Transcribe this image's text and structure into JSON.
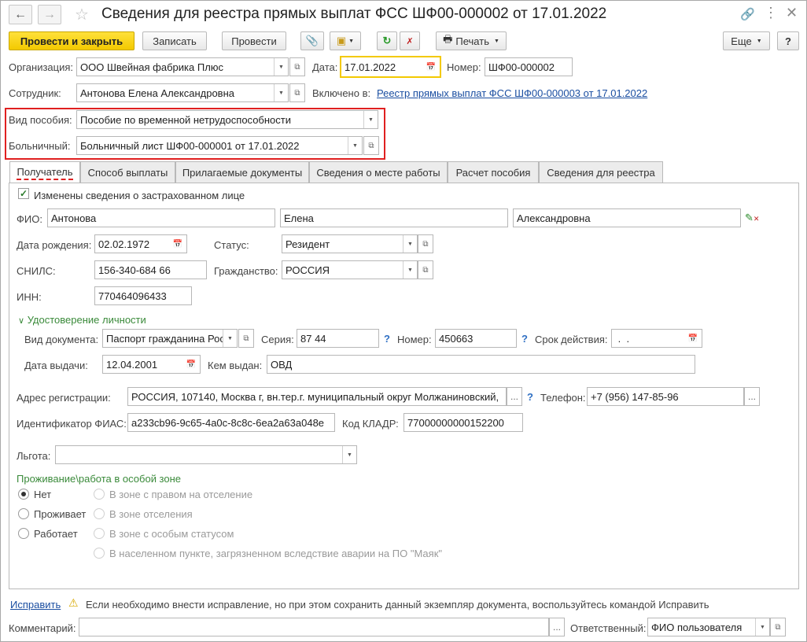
{
  "title": "Сведения для реестра прямых выплат ФСС ШФ00-000002 от 17.01.2022",
  "toolbar": {
    "post_close": "Провести и закрыть",
    "save": "Записать",
    "post": "Провести",
    "print": "Печать",
    "more": "Еще",
    "help": "?"
  },
  "header": {
    "org_label": "Организация:",
    "org_value": "ООО Швейная фабрика Плюс",
    "date_label": "Дата:",
    "date_value": "17.01.2022",
    "number_label": "Номер:",
    "number_value": "ШФ00-000002",
    "employee_label": "Сотрудник:",
    "employee_value": "Антонова Елена Александровна",
    "included_label": "Включено в:",
    "included_link": "Реестр прямых выплат ФСС ШФ00-000003 от 17.01.2022",
    "benefit_label": "Вид пособия:",
    "benefit_value": "Пособие по временной нетрудоспособности",
    "sick_label": "Больничный:",
    "sick_value": "Больничный лист ШФ00-000001 от 17.01.2022"
  },
  "tabs": [
    "Получатель",
    "Способ выплаты",
    "Прилагаемые документы",
    "Сведения о месте работы",
    "Расчет пособия",
    "Сведения для реестра"
  ],
  "recipient": {
    "changed_label": "Изменены сведения о застрахованном лице",
    "changed_checked": true,
    "fio_label": "ФИО:",
    "last_name": "Антонова",
    "first_name": "Елена",
    "middle_name": "Александровна",
    "birth_label": "Дата рождения:",
    "birth_value": "02.02.1972",
    "status_label": "Статус:",
    "status_value": "Резидент",
    "snils_label": "СНИЛС:",
    "snils_value": "156-340-684 66",
    "citizenship_label": "Гражданство:",
    "citizenship_value": "РОССИЯ",
    "inn_label": "ИНН:",
    "inn_value": "770464096433",
    "id_section": "Удостоверение личности",
    "doc_type_label": "Вид документа:",
    "doc_type_value": "Паспорт гражданина Рос",
    "series_label": "Серия:",
    "series_value": "87 44",
    "doc_number_label": "Номер:",
    "doc_number_value": "450663",
    "validity_label": "Срок действия:",
    "validity_value": " .  .",
    "issue_date_label": "Дата выдачи:",
    "issue_date_value": "12.04.2001",
    "issued_by_label": "Кем выдан:",
    "issued_by_value": "ОВД",
    "address_label": "Адрес регистрации:",
    "address_value": "РОССИЯ, 107140, Москва г, вн.тер.г. муниципальный округ Молжаниновский,",
    "phone_label": "Телефон:",
    "phone_value": "+7 (956) 147-85-96",
    "fias_label": "Идентификатор ФИАС:",
    "fias_value": "a233cb96-9c65-4a0c-8c8c-6ea2a63a048e",
    "kladr_label": "Код КЛАДР:",
    "kladr_value": "77000000000152200",
    "benefit_label": "Льгота:",
    "zone_title": "Проживание\\работа в особой зоне",
    "zone_left": [
      "Нет",
      "Проживает",
      "Работает"
    ],
    "zone_right": [
      "В зоне с правом на отселение",
      "В зоне отселения",
      "В зоне с особым статусом",
      "В населенном пункте, загрязненном вследствие аварии на ПО \"Маяк\""
    ]
  },
  "footer": {
    "fix_link": "Исправить",
    "warning": "Если необходимо внести исправление, но при этом сохранить данный экземпляр документа, воспользуйтесь командой Исправить",
    "comment_label": "Комментарий:",
    "responsible_label": "Ответственный:",
    "responsible_value": "ФИО пользователя"
  },
  "colors": {
    "accent": "#f3c900",
    "highlight_box": "#e02020",
    "link": "#1a4ea1",
    "section": "#3a8a3a"
  }
}
